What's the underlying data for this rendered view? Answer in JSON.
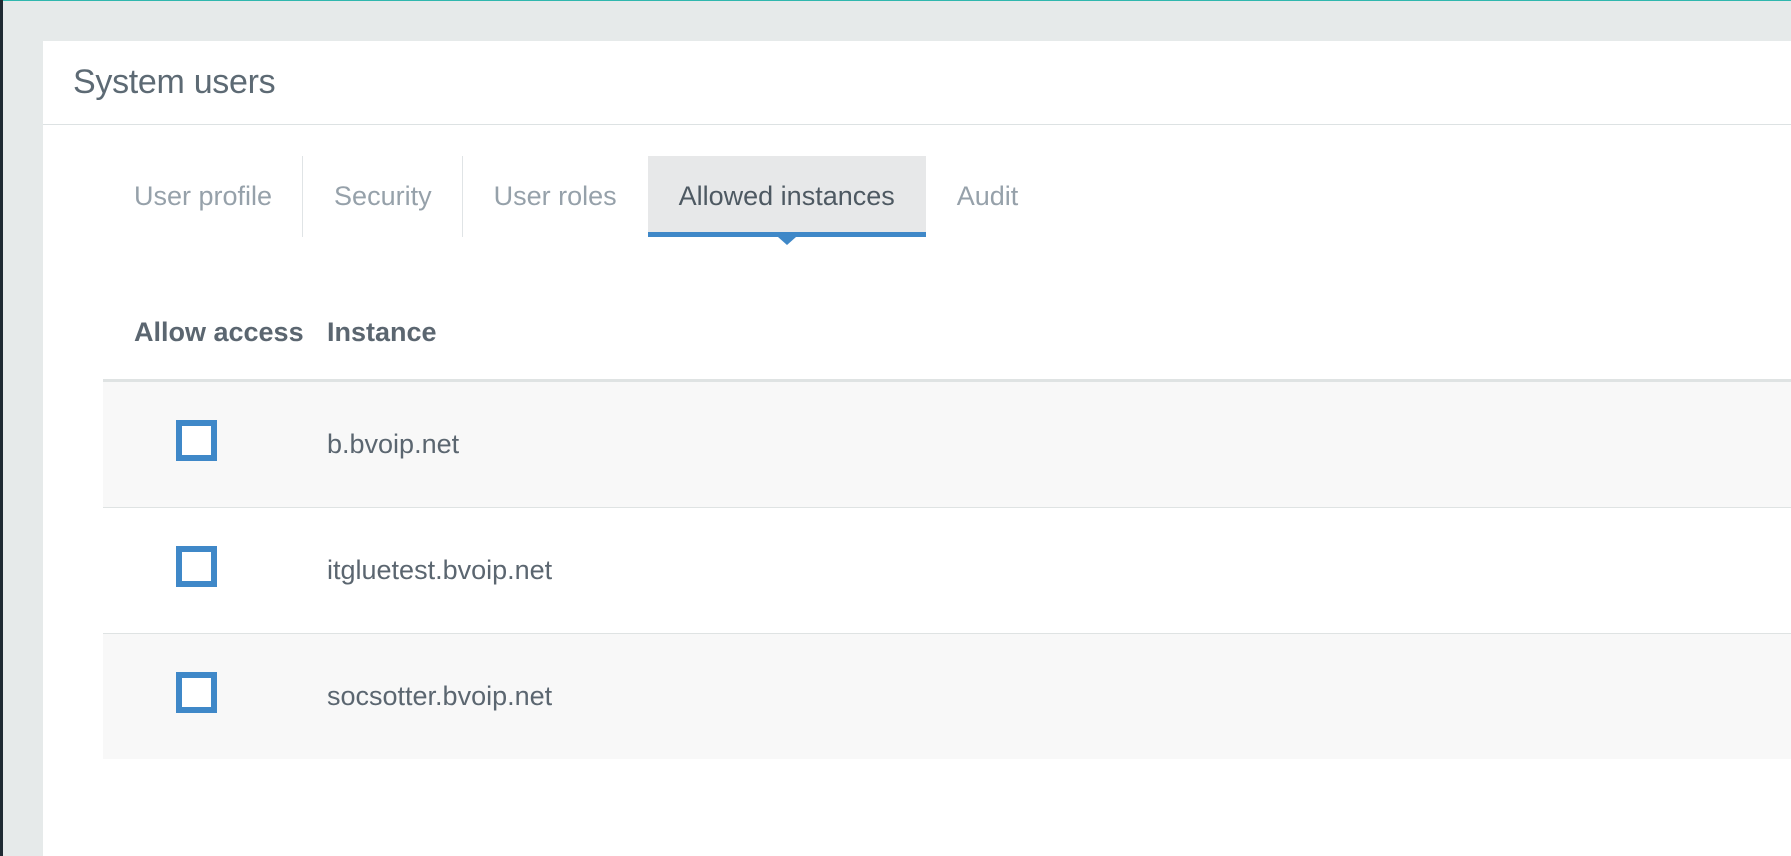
{
  "page": {
    "title": "System users"
  },
  "tabs": [
    {
      "label": "User profile",
      "active": false
    },
    {
      "label": "Security",
      "active": false
    },
    {
      "label": "User roles",
      "active": false
    },
    {
      "label": "Allowed instances",
      "active": true
    },
    {
      "label": "Audit",
      "active": false
    }
  ],
  "table": {
    "columns": [
      "Allow access",
      "Instance"
    ],
    "rows": [
      {
        "allowed": false,
        "instance": "b.bvoip.net"
      },
      {
        "allowed": false,
        "instance": "itgluetest.bvoip.net"
      },
      {
        "allowed": false,
        "instance": "socsotter.bvoip.net"
      }
    ]
  },
  "colors": {
    "accent": "#3f88c8",
    "top_bar": "#2fb7ae",
    "background": "#e6eaea"
  }
}
